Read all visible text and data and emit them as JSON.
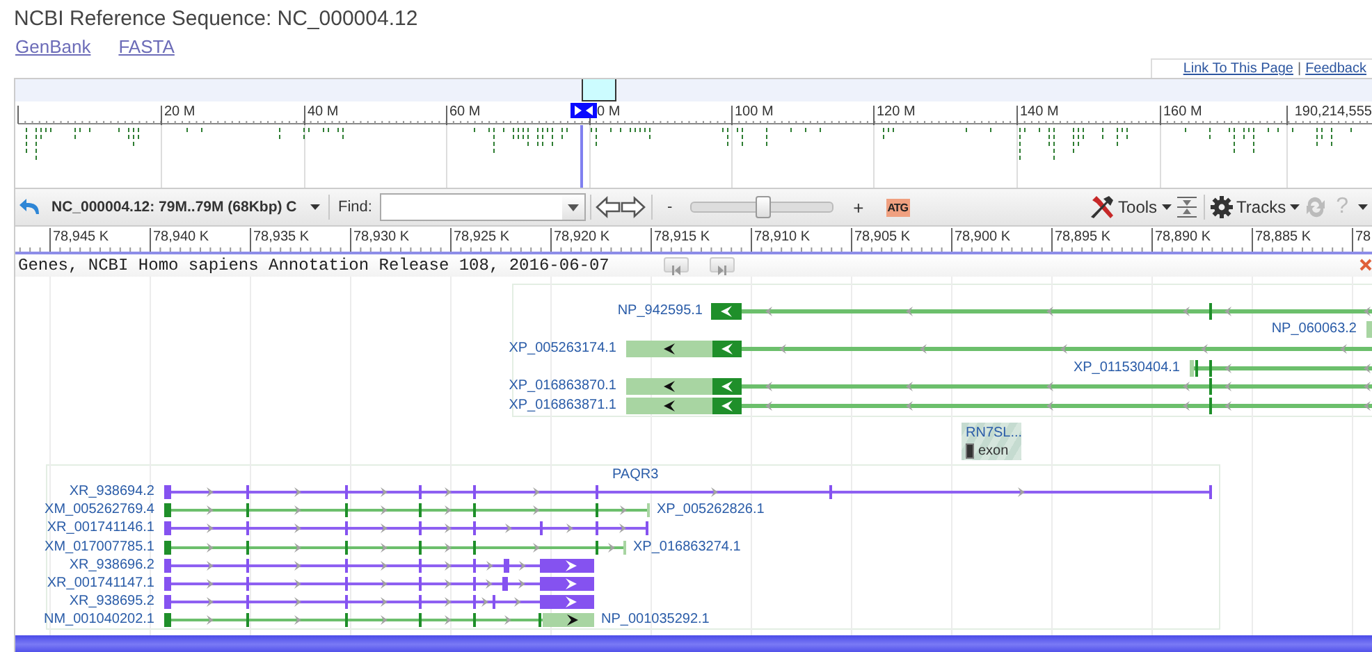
{
  "header": {
    "title": "NCBI Reference Sequence: NC_000004.12",
    "links": [
      "GenBank",
      "FASTA"
    ]
  },
  "page_links": {
    "items": [
      "Link To This Page",
      "Feedback"
    ],
    "separator": "|"
  },
  "overview": {
    "ruler_labels": [
      "20 M",
      "40 M",
      "60 M",
      "0 M",
      "100 M",
      "120 M",
      "140 M",
      "160 M",
      "190,214,555"
    ]
  },
  "toolbar": {
    "location": "NC_000004.12: 79M..79M (68Kbp) C",
    "find_label": "Find:",
    "zoom_out": "-",
    "zoom_in": "+",
    "zoom": {
      "level": 0.5
    },
    "sequence_button": "ATG",
    "tools": "Tools",
    "tracks": "Tracks",
    "help": "?"
  },
  "ruler_labels": [
    "78,945 K",
    "78,940 K",
    "78,935 K",
    "78,930 K",
    "78,925 K",
    "78,920 K",
    "78,915 K",
    "78,910 K",
    "78,905 K",
    "78,900 K",
    "78,895 K",
    "78,890 K",
    "78,885 K",
    "78"
  ],
  "track": {
    "title": "Genes, NCBI Homo sapiens Annotation Release 108, 2016-06-07",
    "minus_group": [
      {
        "label": "NP_942595.1",
        "kind": "coding"
      },
      {
        "label": "NP_060063.2",
        "kind": "coding"
      },
      {
        "label": "XP_005263174.1",
        "kind": "coding"
      },
      {
        "label": "XP_011530404.1",
        "kind": "coding"
      },
      {
        "label": "XP_016863870.1",
        "kind": "coding"
      },
      {
        "label": "XP_016863871.1",
        "kind": "coding"
      }
    ],
    "other_feature": {
      "label": "RN7SL...",
      "legend": "exon"
    },
    "gene_group": {
      "name": "PAQR3",
      "transcripts": [
        {
          "label": "XR_938694.2",
          "kind": "noncoding"
        },
        {
          "label": "XM_005262769.4",
          "kind": "coding",
          "protein": "XP_005262826.1"
        },
        {
          "label": "XR_001741146.1",
          "kind": "noncoding"
        },
        {
          "label": "XM_017007785.1",
          "kind": "coding",
          "protein": "XP_016863274.1"
        },
        {
          "label": "XR_938696.2",
          "kind": "noncoding"
        },
        {
          "label": "XR_001741147.1",
          "kind": "noncoding"
        },
        {
          "label": "XR_938695.2",
          "kind": "noncoding"
        },
        {
          "label": "NM_001040202.1",
          "kind": "coding",
          "protein": "NP_001035292.1"
        }
      ]
    }
  }
}
